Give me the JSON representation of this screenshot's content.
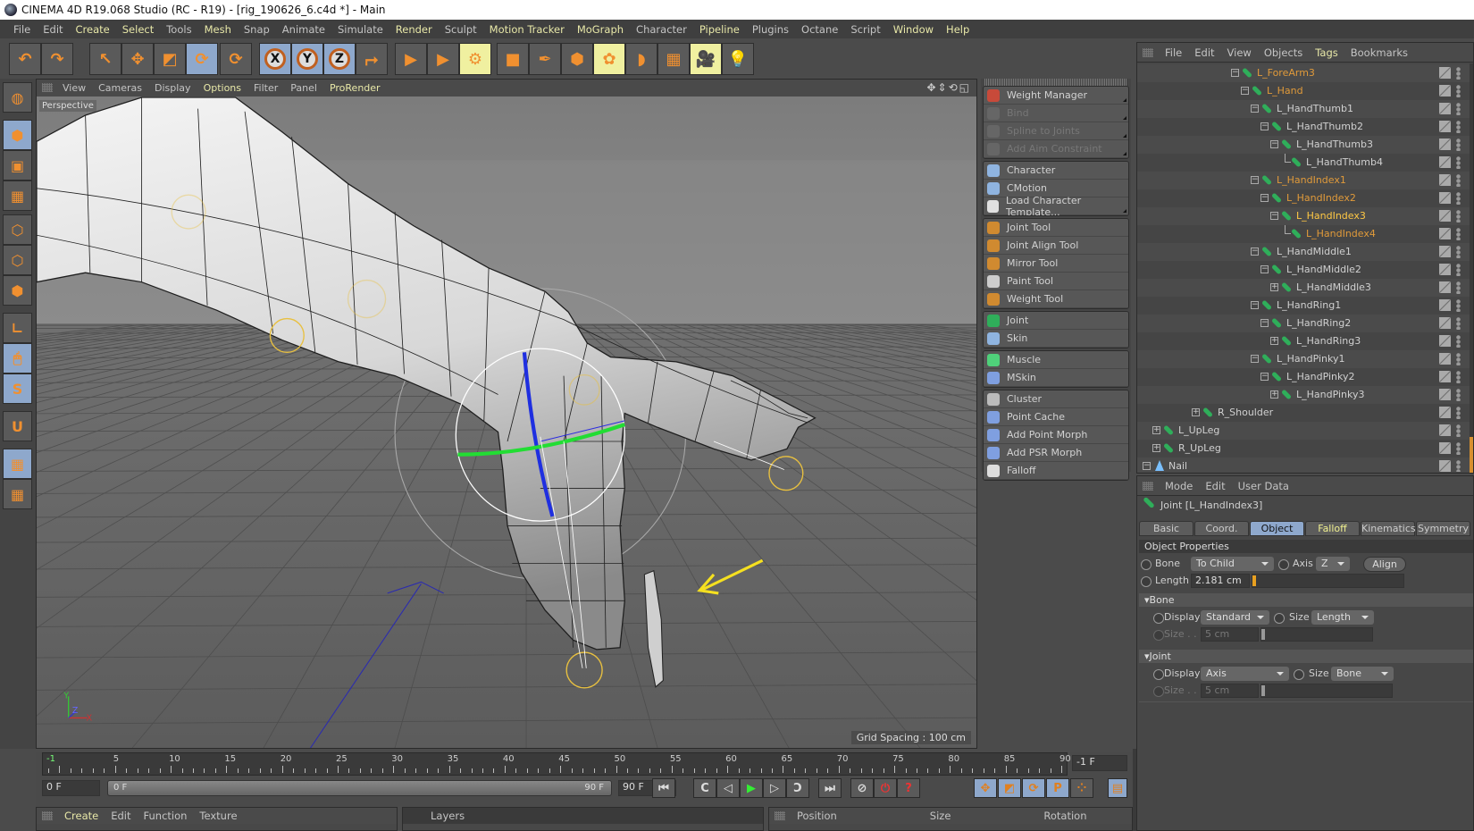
{
  "window": {
    "title": "CINEMA 4D R19.068 Studio (RC - R19) - [rig_190626_6.c4d *] - Main"
  },
  "menubar": [
    {
      "label": "File",
      "hl": false
    },
    {
      "label": "Edit",
      "hl": false
    },
    {
      "label": "Create",
      "hl": true
    },
    {
      "label": "Select",
      "hl": true
    },
    {
      "label": "Tools",
      "hl": false
    },
    {
      "label": "Mesh",
      "hl": true
    },
    {
      "label": "Snap",
      "hl": false
    },
    {
      "label": "Animate",
      "hl": false
    },
    {
      "label": "Simulate",
      "hl": false
    },
    {
      "label": "Render",
      "hl": true
    },
    {
      "label": "Sculpt",
      "hl": false
    },
    {
      "label": "Motion Tracker",
      "hl": true
    },
    {
      "label": "MoGraph",
      "hl": true
    },
    {
      "label": "Character",
      "hl": false
    },
    {
      "label": "Pipeline",
      "hl": true
    },
    {
      "label": "Plugins",
      "hl": false
    },
    {
      "label": "Octane",
      "hl": false
    },
    {
      "label": "Script",
      "hl": false
    },
    {
      "label": "Window",
      "hl": true
    },
    {
      "label": "Help",
      "hl": true
    }
  ],
  "toolbar": [
    {
      "icon": "undo-icon",
      "glyph": "↶",
      "state": ""
    },
    {
      "icon": "redo-icon",
      "glyph": "↷",
      "state": ""
    },
    {
      "icon": "live-selection-icon",
      "glyph": "↖",
      "state": ""
    },
    {
      "icon": "move-icon",
      "glyph": "✥",
      "state": ""
    },
    {
      "icon": "scale-icon",
      "glyph": "◩",
      "state": ""
    },
    {
      "icon": "rotate-icon",
      "glyph": "⟳",
      "state": "on"
    },
    {
      "icon": "recent-tool-icon",
      "glyph": "⟳",
      "state": ""
    },
    {
      "icon": "x-axis-icon",
      "glyph": "X",
      "state": "on",
      "axis": true
    },
    {
      "icon": "y-axis-icon",
      "glyph": "Y",
      "state": "on",
      "axis": true
    },
    {
      "icon": "z-axis-icon",
      "glyph": "Z",
      "state": "on",
      "axis": true
    },
    {
      "icon": "coordinate-system-icon",
      "glyph": "⮣",
      "state": ""
    },
    {
      "icon": "render-view-icon",
      "glyph": "▶",
      "state": ""
    },
    {
      "icon": "render-picture-viewer-icon",
      "glyph": "▶",
      "state": ""
    },
    {
      "icon": "render-settings-icon",
      "glyph": "⚙",
      "state": "yel"
    },
    {
      "icon": "cube-icon",
      "glyph": "■",
      "state": ""
    },
    {
      "icon": "pen-icon",
      "glyph": "✒",
      "state": ""
    },
    {
      "icon": "subdivision-icon",
      "glyph": "⬢",
      "state": ""
    },
    {
      "icon": "cloner-icon",
      "glyph": "✿",
      "state": "yel"
    },
    {
      "icon": "deformer-icon",
      "glyph": "◗",
      "state": ""
    },
    {
      "icon": "floor-icon",
      "glyph": "▦",
      "state": ""
    },
    {
      "icon": "camera-icon",
      "glyph": "🎥",
      "state": "yel"
    },
    {
      "icon": "light-icon",
      "glyph": "💡",
      "state": ""
    }
  ],
  "left_tools": [
    {
      "icon": "make-editable-icon",
      "glyph": "◍",
      "state": ""
    },
    {
      "icon": "model-mode-icon",
      "glyph": "⬢",
      "state": "on"
    },
    {
      "icon": "texture-mode-icon",
      "glyph": "▣",
      "state": ""
    },
    {
      "icon": "workplane-icon",
      "glyph": "▦",
      "state": ""
    },
    {
      "icon": "points-mode-icon",
      "glyph": "⬡",
      "state": ""
    },
    {
      "icon": "edges-mode-icon",
      "glyph": "⬡",
      "state": ""
    },
    {
      "icon": "polygons-mode-icon",
      "glyph": "⬢",
      "state": ""
    },
    {
      "icon": "axis-mode-icon",
      "glyph": "∟",
      "state": ""
    },
    {
      "icon": "tweak-mode-icon",
      "glyph": "🖱",
      "state": "on"
    },
    {
      "icon": "solo-icon",
      "glyph": "S",
      "state": "on"
    },
    {
      "icon": "snap-icon",
      "glyph": "U",
      "state": ""
    },
    {
      "icon": "workplane-lock-icon",
      "glyph": "▦",
      "state": "on"
    },
    {
      "icon": "workplane-align-icon",
      "glyph": "▦",
      "state": ""
    }
  ],
  "viewport": {
    "menu": [
      {
        "label": "View",
        "hl": false
      },
      {
        "label": "Cameras",
        "hl": false
      },
      {
        "label": "Display",
        "hl": false
      },
      {
        "label": "Options",
        "hl": true
      },
      {
        "label": "Filter",
        "hl": false
      },
      {
        "label": "Panel",
        "hl": false
      },
      {
        "label": "ProRender",
        "hl": true
      }
    ],
    "camera_label": "Perspective",
    "grid_spacing": "Grid Spacing : 100 cm",
    "nav_icons": "✥⇕⟲◱",
    "axis_labels": {
      "y": "Y",
      "z": "Z",
      "x": "X"
    }
  },
  "tool_panel": {
    "groups": [
      [
        {
          "label": "Weight Manager",
          "icon": "weight-manager-icon",
          "color": "#c84a3a",
          "disabled": false,
          "corner": true
        },
        {
          "label": "Bind",
          "icon": "bind-icon",
          "color": "#666",
          "disabled": true,
          "corner": true
        },
        {
          "label": "Spline to Joints",
          "icon": "spline-to-joints-icon",
          "color": "#666",
          "disabled": true,
          "corner": true
        },
        {
          "label": "Add Aim Constraint",
          "icon": "aim-constraint-icon",
          "color": "#666",
          "disabled": true,
          "corner": true
        }
      ],
      [
        {
          "label": "Character",
          "icon": "character-icon",
          "color": "#8fb4e0",
          "disabled": false,
          "corner": false
        },
        {
          "label": "CMotion",
          "icon": "cmotion-icon",
          "color": "#8fb4e0",
          "disabled": false,
          "corner": false
        },
        {
          "label": "Load Character Template...",
          "icon": "load-template-icon",
          "color": "#e0e0e0",
          "disabled": false,
          "corner": true
        }
      ],
      [
        {
          "label": "Joint Tool",
          "icon": "joint-tool-icon",
          "color": "#d08a30",
          "disabled": false,
          "corner": false
        },
        {
          "label": "Joint Align Tool",
          "icon": "joint-align-tool-icon",
          "color": "#d08a30",
          "disabled": false,
          "corner": false
        },
        {
          "label": "Mirror Tool",
          "icon": "mirror-tool-icon",
          "color": "#d08a30",
          "disabled": false,
          "corner": false
        },
        {
          "label": "Paint Tool",
          "icon": "paint-tool-icon",
          "color": "#cccccc",
          "disabled": false,
          "corner": false
        },
        {
          "label": "Weight Tool",
          "icon": "weight-tool-icon",
          "color": "#d08a30",
          "disabled": false,
          "corner": false
        }
      ],
      [
        {
          "label": "Joint",
          "icon": "joint-icon",
          "color": "#2fae5a",
          "disabled": false,
          "corner": false
        },
        {
          "label": "Skin",
          "icon": "skin-icon",
          "color": "#8fb4e0",
          "disabled": false,
          "corner": false
        }
      ],
      [
        {
          "label": "Muscle",
          "icon": "muscle-icon",
          "color": "#4fd07a",
          "disabled": false,
          "corner": false
        },
        {
          "label": "MSkin",
          "icon": "mskin-icon",
          "color": "#7f9fe0",
          "disabled": false,
          "corner": false
        }
      ],
      [
        {
          "label": "Cluster",
          "icon": "cluster-icon",
          "color": "#bbbbbb",
          "disabled": false,
          "corner": false
        },
        {
          "label": "Point Cache",
          "icon": "point-cache-icon",
          "color": "#7f9fe0",
          "disabled": false,
          "corner": false
        },
        {
          "label": "Add Point Morph",
          "icon": "point-morph-icon",
          "color": "#7f9fe0",
          "disabled": false,
          "corner": false
        },
        {
          "label": "Add PSR Morph",
          "icon": "psr-morph-icon",
          "color": "#7f9fe0",
          "disabled": false,
          "corner": false
        },
        {
          "label": "Falloff",
          "icon": "falloff-icon",
          "color": "#dddddd",
          "disabled": false,
          "corner": false
        }
      ]
    ]
  },
  "object_manager": {
    "menu": [
      {
        "label": "File",
        "hl": false
      },
      {
        "label": "Edit",
        "hl": false
      },
      {
        "label": "View",
        "hl": false
      },
      {
        "label": "Objects",
        "hl": false
      },
      {
        "label": "Tags",
        "hl": true
      },
      {
        "label": "Bookmarks",
        "hl": false
      }
    ],
    "colors": {
      "normal": "#d0d0d0",
      "highlight": "#e09a3a",
      "selected": "#ffc844"
    },
    "rows": [
      {
        "name": "L_ForeArm3",
        "depth": 9,
        "exp": "-",
        "state": "highlight"
      },
      {
        "name": "L_Hand",
        "depth": 10,
        "exp": "-",
        "state": "highlight"
      },
      {
        "name": "L_HandThumb1",
        "depth": 11,
        "exp": "-",
        "state": "normal"
      },
      {
        "name": "L_HandThumb2",
        "depth": 12,
        "exp": "-",
        "state": "normal"
      },
      {
        "name": "L_HandThumb3",
        "depth": 13,
        "exp": "-",
        "state": "normal"
      },
      {
        "name": "L_HandThumb4",
        "depth": 14,
        "exp": "",
        "state": "normal"
      },
      {
        "name": "L_HandIndex1",
        "depth": 11,
        "exp": "-",
        "state": "highlight"
      },
      {
        "name": "L_HandIndex2",
        "depth": 12,
        "exp": "-",
        "state": "highlight"
      },
      {
        "name": "L_HandIndex3",
        "depth": 13,
        "exp": "-",
        "state": "selected"
      },
      {
        "name": "L_HandIndex4",
        "depth": 14,
        "exp": "",
        "state": "highlight"
      },
      {
        "name": "L_HandMiddle1",
        "depth": 11,
        "exp": "-",
        "state": "normal"
      },
      {
        "name": "L_HandMiddle2",
        "depth": 12,
        "exp": "-",
        "state": "normal"
      },
      {
        "name": "L_HandMiddle3",
        "depth": 13,
        "exp": "+",
        "state": "normal"
      },
      {
        "name": "L_HandRing1",
        "depth": 11,
        "exp": "-",
        "state": "normal"
      },
      {
        "name": "L_HandRing2",
        "depth": 12,
        "exp": "-",
        "state": "normal"
      },
      {
        "name": "L_HandRing3",
        "depth": 13,
        "exp": "+",
        "state": "normal"
      },
      {
        "name": "L_HandPinky1",
        "depth": 11,
        "exp": "-",
        "state": "normal"
      },
      {
        "name": "L_HandPinky2",
        "depth": 12,
        "exp": "-",
        "state": "normal"
      },
      {
        "name": "L_HandPinky3",
        "depth": 13,
        "exp": "+",
        "state": "normal"
      },
      {
        "name": "R_Shoulder",
        "depth": 5,
        "exp": "+",
        "state": "normal"
      },
      {
        "name": "L_UpLeg",
        "depth": 1,
        "exp": "+",
        "state": "normal"
      },
      {
        "name": "R_UpLeg",
        "depth": 1,
        "exp": "+",
        "state": "normal"
      },
      {
        "name": "Nail",
        "depth": 0,
        "exp": "-",
        "state": "normal",
        "type": "null"
      }
    ]
  },
  "attributes": {
    "menu": [
      {
        "label": "Mode",
        "hl": false
      },
      {
        "label": "Edit",
        "hl": false
      },
      {
        "label": "User Data",
        "hl": false
      }
    ],
    "title": "Joint [L_HandIndex3]",
    "tabs": [
      {
        "label": "Basic",
        "state": ""
      },
      {
        "label": "Coord.",
        "state": ""
      },
      {
        "label": "Object",
        "state": "on"
      },
      {
        "label": "Falloff",
        "state": "fall"
      },
      {
        "label": "Kinematics",
        "state": ""
      },
      {
        "label": "Symmetry",
        "state": ""
      }
    ],
    "section": "Object Properties",
    "bone_label": "Bone",
    "bone_value": "To Child",
    "axis_label": "Axis",
    "axis_value": "Z",
    "align_label": "Align",
    "length_label": "Length",
    "length_value": "2.181 cm",
    "length_slider_fraction": 0.02,
    "bone_group": {
      "header": "Bone",
      "display_label": "Display",
      "display_value": "Standard",
      "size_label": "Size",
      "size_value": "Length",
      "size2_label": "Size . . .",
      "size2_value": "5 cm"
    },
    "joint_group": {
      "header": "Joint",
      "display_label": "Display",
      "display_value": "Axis",
      "size_label": "Size",
      "size_value": "Bone",
      "size2_label": "Size . . .",
      "size2_value": "5 cm"
    }
  },
  "timeline": {
    "ruler_start": -1,
    "ruler_end": 90,
    "ticks": [
      "-1",
      "5",
      "10",
      "15",
      "20",
      "25",
      "30",
      "35",
      "40",
      "45",
      "50",
      "55",
      "60",
      "65",
      "70",
      "75",
      "80",
      "85",
      "90"
    ],
    "current_frame": "-1 F",
    "start_field": "0 F",
    "range_start": "0 F",
    "range_end": "90 F",
    "end_field": "90 F",
    "transport": [
      {
        "icon": "go-to-start-icon",
        "glyph": "⏮"
      },
      {
        "icon": "previous-key-icon",
        "glyph": "C"
      },
      {
        "icon": "previous-frame-icon",
        "glyph": "◁"
      },
      {
        "icon": "play-icon",
        "glyph": "▶"
      },
      {
        "icon": "next-frame-icon",
        "glyph": "▷"
      },
      {
        "icon": "next-key-icon",
        "glyph": "Ↄ"
      },
      {
        "icon": "go-to-end-icon",
        "glyph": "⏭"
      },
      {
        "icon": "record-disabled-icon",
        "glyph": "⊘"
      },
      {
        "icon": "autokey-icon",
        "glyph": "⏻"
      },
      {
        "icon": "keyframe-selection-icon",
        "glyph": "?"
      }
    ],
    "key_buttons": [
      {
        "icon": "key-position-icon",
        "glyph": "✥"
      },
      {
        "icon": "key-scale-icon",
        "glyph": "◩"
      },
      {
        "icon": "key-rotation-icon",
        "glyph": "⟳"
      },
      {
        "icon": "key-parameter-icon",
        "glyph": "P"
      },
      {
        "icon": "key-pla-icon",
        "glyph": "⁘"
      }
    ],
    "film_icon": "timeline-icon"
  },
  "bottom": {
    "materials_menu": [
      {
        "label": "Create",
        "hl": true
      },
      {
        "label": "Edit",
        "hl": false
      },
      {
        "label": "Function",
        "hl": false
      },
      {
        "label": "Texture",
        "hl": false
      }
    ],
    "layers_title": "Layers",
    "coords_headers": [
      "Position",
      "Size",
      "Rotation"
    ]
  }
}
